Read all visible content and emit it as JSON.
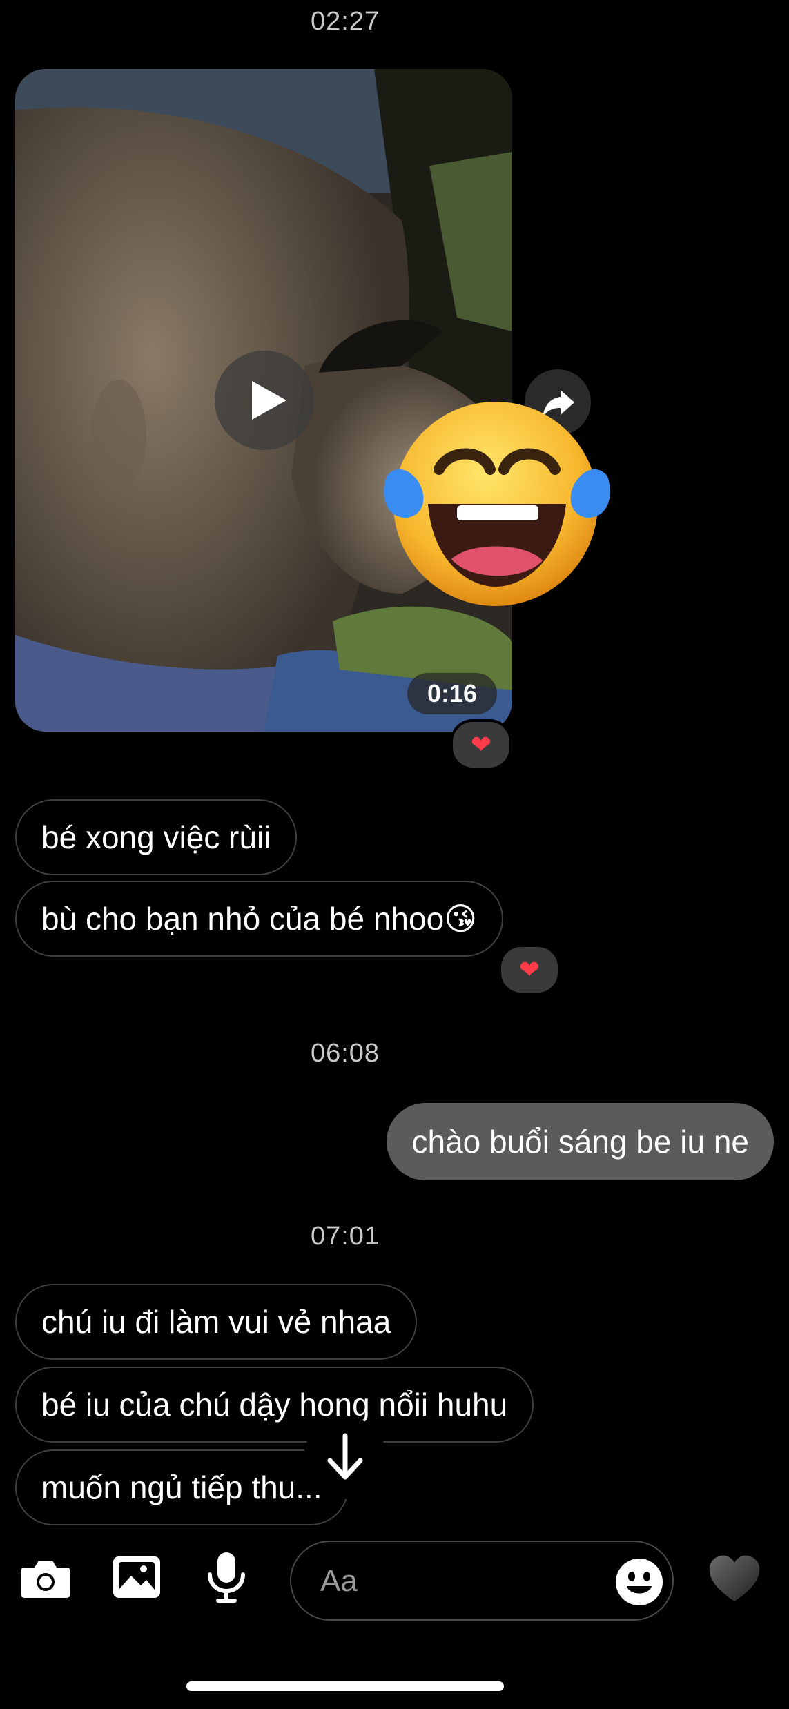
{
  "colors": {
    "background": "#000000",
    "incoming_bubble_border": "#3f3f3f",
    "outgoing_bubble": "#5b5b5b",
    "timestamp_text": "#c9c9c9",
    "reaction_heart": "#ff3b4a"
  },
  "thread": {
    "timestamps": [
      "02:27",
      "06:08",
      "07:01"
    ],
    "video_message": {
      "duration": "0:16",
      "play_icon": "play-icon",
      "share_icon": "share-icon",
      "overlay_emoji": "laughing-tears-emoji",
      "reaction": "❤"
    },
    "group1": {
      "messages": [
        "bé xong việc rùii",
        "bù cho bạn nhỏ của bé nhoo😘"
      ],
      "reaction": "❤"
    },
    "outgoing": {
      "text": "chào buổi sáng be iu ne"
    },
    "group2": {
      "messages": [
        "chú iu đi làm vui vẻ nhaa",
        "bé iu của chú dậy hong nổii huhu",
        "muốn ngủ tiếp thu..."
      ]
    }
  },
  "composer": {
    "placeholder": "Aa",
    "icons": [
      "camera-icon",
      "image-icon",
      "microphone-icon",
      "emoji-icon",
      "heart-icon"
    ]
  }
}
